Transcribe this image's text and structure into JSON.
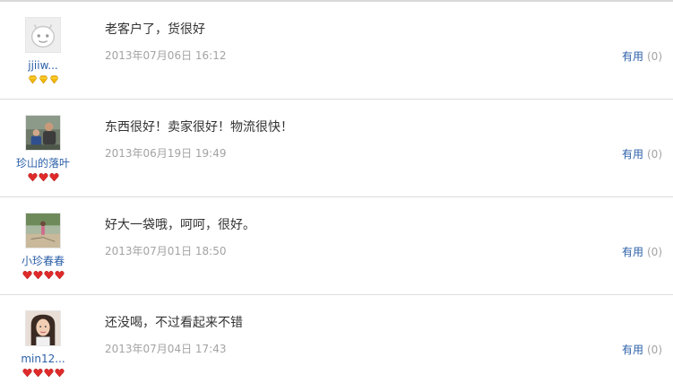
{
  "reviews": [
    {
      "username": "jjiiw...",
      "avatar_icon": "default-face-avatar",
      "badge_icon": "gold-diamond-icon",
      "badge_color": "#f5b800",
      "badge_count": 3,
      "text": "老客户了，货很好",
      "date": "2013年07月06日 16:12",
      "helpful_label": "有用",
      "helpful_count": "(0)"
    },
    {
      "username": "珍山的落叶",
      "avatar_icon": "photo-avatar-two-people",
      "badge_icon": "red-heart-icon",
      "badge_color": "#e02a2a",
      "badge_count": 3,
      "text": "东西很好！卖家很好！物流很快！",
      "date": "2013年06月19日 19:49",
      "helpful_label": "有用",
      "helpful_count": "(0)"
    },
    {
      "username": "小珍春春",
      "avatar_icon": "photo-avatar-outdoor",
      "badge_icon": "red-heart-icon",
      "badge_color": "#e02a2a",
      "badge_count": 4,
      "text": "好大一袋哦，呵呵，很好。",
      "date": "2013年07月01日 18:50",
      "helpful_label": "有用",
      "helpful_count": "(0)"
    },
    {
      "username": "min12...",
      "avatar_icon": "photo-avatar-woman",
      "badge_icon": "red-heart-icon",
      "badge_color": "#e02a2a",
      "badge_count": 4,
      "text": "还没喝，不过看起来不错",
      "date": "2013年07月04日 17:43",
      "helpful_label": "有用",
      "helpful_count": "(0)"
    }
  ]
}
